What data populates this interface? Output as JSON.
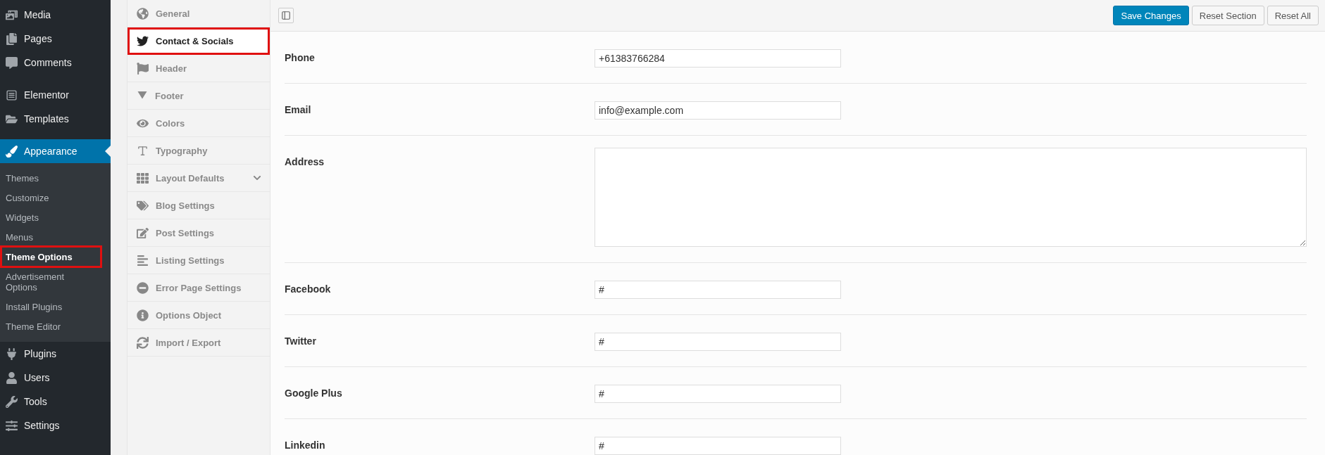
{
  "admin_menu": {
    "groups": [
      {
        "items": [
          {
            "label": "Media",
            "selected": false
          },
          {
            "label": "Pages",
            "selected": false
          },
          {
            "label": "Comments",
            "selected": false
          }
        ]
      },
      {
        "items": [
          {
            "label": "Elementor",
            "selected": false
          },
          {
            "label": "Templates",
            "selected": false
          }
        ]
      },
      {
        "items": [
          {
            "label": "Appearance",
            "selected": true,
            "children": [
              {
                "label": "Themes",
                "selected": false,
                "annotated": false
              },
              {
                "label": "Customize",
                "selected": false,
                "annotated": false
              },
              {
                "label": "Widgets",
                "selected": false,
                "annotated": false
              },
              {
                "label": "Menus",
                "selected": false,
                "annotated": false
              },
              {
                "label": "Theme Options",
                "selected": true,
                "annotated": true
              },
              {
                "label": "Advertisement Options",
                "selected": false,
                "annotated": false
              },
              {
                "label": "Install Plugins",
                "selected": false,
                "annotated": false
              },
              {
                "label": "Theme Editor",
                "selected": false,
                "annotated": false
              }
            ]
          },
          {
            "label": "Plugins",
            "selected": false
          },
          {
            "label": "Users",
            "selected": false
          },
          {
            "label": "Tools",
            "selected": false
          },
          {
            "label": "Settings",
            "selected": false
          }
        ]
      }
    ]
  },
  "options_sidebar": {
    "items": [
      {
        "label": "General",
        "selected": false,
        "annotated": false,
        "expandable": false
      },
      {
        "label": "Contact & Socials",
        "selected": true,
        "annotated": true,
        "expandable": false
      },
      {
        "label": "Header",
        "selected": false,
        "annotated": false,
        "expandable": false
      },
      {
        "label": "Footer",
        "selected": false,
        "annotated": false,
        "expandable": false
      },
      {
        "label": "Colors",
        "selected": false,
        "annotated": false,
        "expandable": false
      },
      {
        "label": "Typography",
        "selected": false,
        "annotated": false,
        "expandable": false
      },
      {
        "label": "Layout Defaults",
        "selected": false,
        "annotated": false,
        "expandable": true
      },
      {
        "label": "Blog Settings",
        "selected": false,
        "annotated": false,
        "expandable": false
      },
      {
        "label": "Post Settings",
        "selected": false,
        "annotated": false,
        "expandable": false
      },
      {
        "label": "Listing Settings",
        "selected": false,
        "annotated": false,
        "expandable": false
      },
      {
        "label": "Error Page Settings",
        "selected": false,
        "annotated": false,
        "expandable": false
      },
      {
        "label": "Options Object",
        "selected": false,
        "annotated": false,
        "expandable": false
      },
      {
        "label": "Import / Export",
        "selected": false,
        "annotated": false,
        "expandable": false
      }
    ]
  },
  "toolbar": {
    "buttons": [
      {
        "label": "Save Changes",
        "kind": "primary"
      },
      {
        "label": "Reset Section",
        "kind": "secondary"
      },
      {
        "label": "Reset All",
        "kind": "secondary"
      }
    ]
  },
  "fields": [
    {
      "label": "Phone",
      "kind": "text",
      "value": "+61383766284"
    },
    {
      "label": "Email",
      "kind": "text",
      "value": "info@example.com"
    },
    {
      "label": "Address",
      "kind": "textarea"
    },
    {
      "label": "Facebook",
      "kind": "text",
      "value": "#"
    },
    {
      "label": "Twitter",
      "kind": "text",
      "value": "#"
    },
    {
      "label": "Google Plus",
      "kind": "text",
      "value": "#"
    },
    {
      "label": "Linkedin",
      "kind": "text",
      "value": "#"
    }
  ]
}
